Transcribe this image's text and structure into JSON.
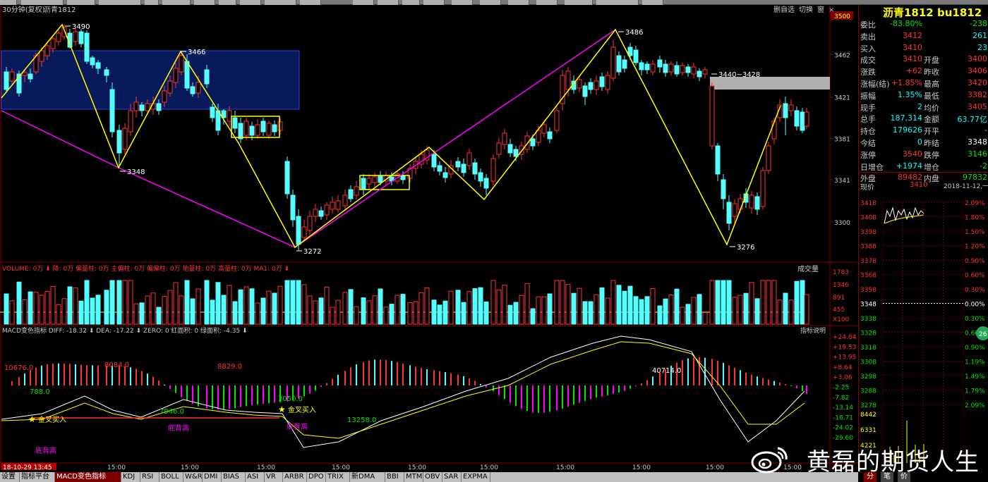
{
  "toolbar": {
    "chart_label": "30分钟(复权)",
    "symbol_label": "沥青1812",
    "right_buttons": [
      "删自选",
      "切换",
      "窗",
      "×"
    ]
  },
  "main": {
    "price_ticks": [
      "3500",
      "3462",
      "3421",
      "3381",
      "3341",
      "3300"
    ],
    "annotations": [
      "3490",
      "3466",
      "3348",
      "3272",
      "3486",
      "3440~3428",
      "3276"
    ],
    "volume_header": "VOLUME: 0万 ⬇  降: 0万  偏量柱: 0万  主偏柱: 0万  偏偏柱: 0万  地量柱: 0万  高量柱: 0万  MA1: 0万 ⬇",
    "volume_ticks": [
      "1783",
      "1346",
      "891",
      "455",
      "X100"
    ],
    "volume_button": "成交量",
    "macd_header": "MACD变色指标  DIFF: -18.32 ⬇  DEA: -17.22 ⬇  ZERO: 0  红面积: 0  绿面积: -4.35 ⬇",
    "macd_button": "指标说明",
    "macd_ticks": [
      "+24.84",
      "+19.53",
      "+13.95",
      "+8.64",
      "+3.06",
      "-2.25",
      "-7.82",
      "-13.14",
      "-18.71",
      "-24.02",
      "-29.60"
    ],
    "macd_labels": [
      "10676.0",
      "8084.0",
      "8829.0",
      "40714.0",
      "788.0",
      "7946.0",
      "3050.0",
      "13258.0"
    ],
    "signals": [
      "金叉买入",
      "金叉买入",
      "底背离",
      "底背离",
      "底背离"
    ],
    "time_labels": [
      "15:00",
      "15:00",
      "15:00",
      "15:00",
      "15:00",
      "15:00",
      "15:00",
      "15:00",
      "15:00",
      "15:00"
    ],
    "start_date": "18-10-29 13:45"
  },
  "quote": {
    "title": "沥青1812 bu1812",
    "rows": [
      {
        "l1": "委比",
        "v1": "-83.80%",
        "c1": "green",
        "l2": "",
        "v2": "-238",
        "c2": "green"
      },
      {
        "l1": "卖出",
        "v1": "3412",
        "c1": "red",
        "l2": "",
        "v2": "261",
        "c2": "cyan"
      },
      {
        "l1": "买入",
        "v1": "3410",
        "c1": "red",
        "l2": "",
        "v2": "23",
        "c2": "cyan"
      },
      {
        "l1": "成交",
        "v1": "3410",
        "c1": "red",
        "l2": "开盘",
        "v2": "3400",
        "c2": "red"
      },
      {
        "l1": "涨跌",
        "v1": "+62",
        "c1": "red",
        "l2": "昨收",
        "v2": "3406",
        "c2": "red"
      },
      {
        "l1": "涨幅(结)",
        "v1": "+1.85%",
        "c1": "red",
        "l2": "最高",
        "v2": "3420",
        "c2": "red"
      },
      {
        "l1": "振幅",
        "v1": "1.35%",
        "c1": "cyan",
        "l2": "最低",
        "v2": "3382",
        "c2": "red"
      },
      {
        "l1": "现手",
        "v1": "2",
        "c1": "cyan",
        "l2": "均价",
        "v2": "3405",
        "c2": "red"
      },
      {
        "l1": "总手",
        "v1": "187,314",
        "c1": "cyan",
        "l2": "金额",
        "v2": "63.77亿",
        "c2": "cyan"
      },
      {
        "l1": "持仓",
        "v1": "179626",
        "c1": "cyan",
        "l2": "开平",
        "v2": "-",
        "c2": "cyan"
      },
      {
        "l1": "今结",
        "v1": "0",
        "c1": "cyan",
        "l2": "昨结",
        "v2": "3348",
        "c2": "white"
      },
      {
        "l1": "涨停",
        "v1": "3540",
        "c1": "red",
        "l2": "跌停",
        "v2": "3146",
        "c2": "green"
      },
      {
        "l1": "日增仓",
        "v1": "+1974",
        "c1": "cyan",
        "l2": "增仓",
        "v2": "-2",
        "c2": "green"
      },
      {
        "l1": "外盘",
        "v1": "89482",
        "c1": "red",
        "l2": "内盘",
        "v2": "97832",
        "c2": "green"
      }
    ],
    "intraday_label": "现价",
    "intraday_price": "3410",
    "intraday_date": "2018-11-12,一",
    "intraday_left_ticks": [
      "3418",
      "3408",
      "3398",
      "3388",
      "3378",
      "3368",
      "3358",
      "3348",
      "3338",
      "3328",
      "3318",
      "3308",
      "3298",
      "3288",
      "3278",
      "8442",
      "6331",
      "4221"
    ],
    "intraday_right_ticks": [
      "2.09%",
      "1.80%",
      "1.50%",
      "1.20%",
      "0.90%",
      "0.60%",
      "0.30%",
      "0.00%",
      "0.30%",
      "0.60%",
      "0.90%",
      "1.19%",
      "1.49%",
      "1.79%",
      "2.09%"
    ],
    "circle_label": "26"
  },
  "bottom_tabs": [
    "设置",
    "指标平台",
    "MACD变色指标",
    "KDJ",
    "RSI",
    "BOLL",
    "W&R",
    "DMI",
    "BIAS",
    "ASI",
    "VR",
    "ARBR",
    "DPO",
    "TRIX",
    "新DMA",
    "BBI",
    "MTM",
    "OBV",
    "SAR",
    "EXPMA"
  ],
  "right_tabs": [
    "分",
    "笔",
    "价"
  ],
  "watermark": "黄磊的期货人生"
}
